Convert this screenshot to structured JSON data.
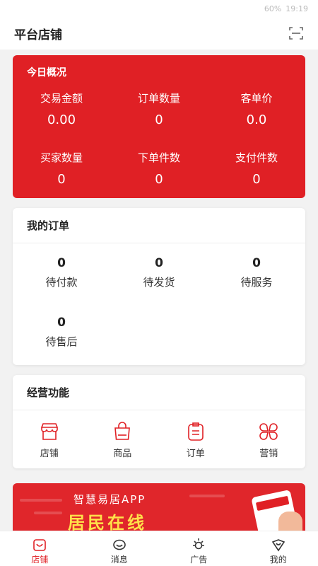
{
  "statusbar": {
    "battery": "60%",
    "time": "19:19"
  },
  "header": {
    "title": "平台店铺"
  },
  "overview": {
    "title": "今日概况",
    "stats": [
      {
        "label": "交易金额",
        "value": "0.00"
      },
      {
        "label": "订单数量",
        "value": "0"
      },
      {
        "label": "客单价",
        "value": "0.0"
      },
      {
        "label": "买家数量",
        "value": "0"
      },
      {
        "label": "下单件数",
        "value": "0"
      },
      {
        "label": "支付件数",
        "value": "0"
      }
    ]
  },
  "orders": {
    "title": "我的订单",
    "items": [
      {
        "count": "0",
        "label": "待付款"
      },
      {
        "count": "0",
        "label": "待发货"
      },
      {
        "count": "0",
        "label": "待服务"
      },
      {
        "count": "0",
        "label": "待售后"
      }
    ]
  },
  "business": {
    "title": "经营功能",
    "items": [
      {
        "label": "店铺",
        "icon": "store-icon"
      },
      {
        "label": "商品",
        "icon": "bag-icon"
      },
      {
        "label": "订单",
        "icon": "clipboard-icon"
      },
      {
        "label": "营销",
        "icon": "clover-icon"
      }
    ]
  },
  "banner": {
    "line1": "智慧易居APP",
    "line2": "居民在线"
  },
  "tabbar": {
    "items": [
      {
        "label": "店铺",
        "icon": "store-tab-icon",
        "active": true
      },
      {
        "label": "消息",
        "icon": "message-icon",
        "active": false
      },
      {
        "label": "广告",
        "icon": "sun-icon",
        "active": false
      },
      {
        "label": "我的",
        "icon": "heart-icon",
        "active": false
      }
    ]
  },
  "colors": {
    "accent": "#e02025",
    "banner_text": "#ffe14a"
  }
}
